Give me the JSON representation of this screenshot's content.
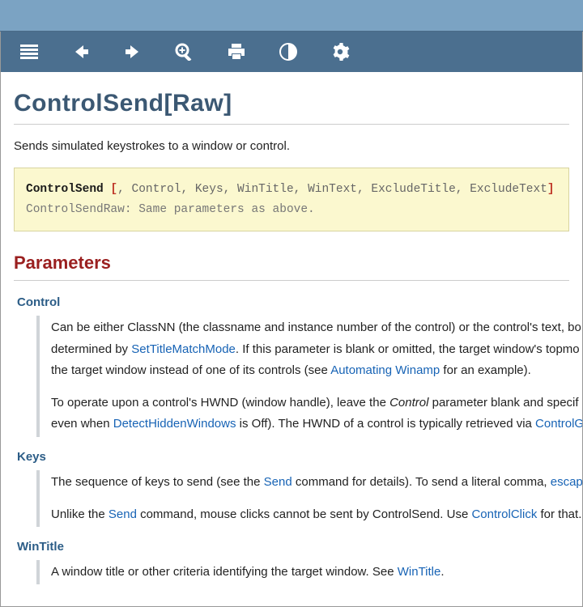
{
  "title": "ControlSend[Raw]",
  "lead": "Sends simulated keystrokes to a window or control.",
  "syntax": {
    "cmd": "ControlSend",
    "open_bracket": " [",
    "args": ", Control, Keys, WinTitle, WinText, ExcludeTitle, ExcludeText",
    "close_bracket": "]",
    "line2": "ControlSendRaw: Same parameters as above."
  },
  "h2": "Parameters",
  "params": {
    "control": {
      "name": "Control",
      "p1a": "Can be either ClassNN (the classname and instance number of the control) or the control's text, bo",
      "p1b": "determined by ",
      "link1": "SetTitleMatchMode",
      "p1c": ". If this parameter is blank or omitted, the target window's topmo",
      "p1d": "the target window instead of one of its controls (see ",
      "link2": "Automating Winamp",
      "p1e": " for an example).",
      "p2a": "To operate upon a control's HWND (window handle), leave the ",
      "p2i": "Control",
      "p2b": " parameter blank and specif",
      "p2c": "even when ",
      "link3": "DetectHiddenWindows",
      "p2d": " is Off). The HWND of a control is typically retrieved via ",
      "link4": "ControlG"
    },
    "keys": {
      "name": "Keys",
      "p1a": "The sequence of keys to send (see the ",
      "link1": "Send",
      "p1b": " command for details). To send a literal comma, ",
      "link2": "escap",
      "p2a": "Unlike the ",
      "link3": "Send",
      "p2b": " command, mouse clicks cannot be sent by ControlSend. Use ",
      "link4": "ControlClick",
      "p2c": " for that."
    },
    "wintitle": {
      "name": "WinTitle",
      "p1a": "A window title or other criteria identifying the target window. See ",
      "link1": "WinTitle",
      "p1b": "."
    }
  }
}
